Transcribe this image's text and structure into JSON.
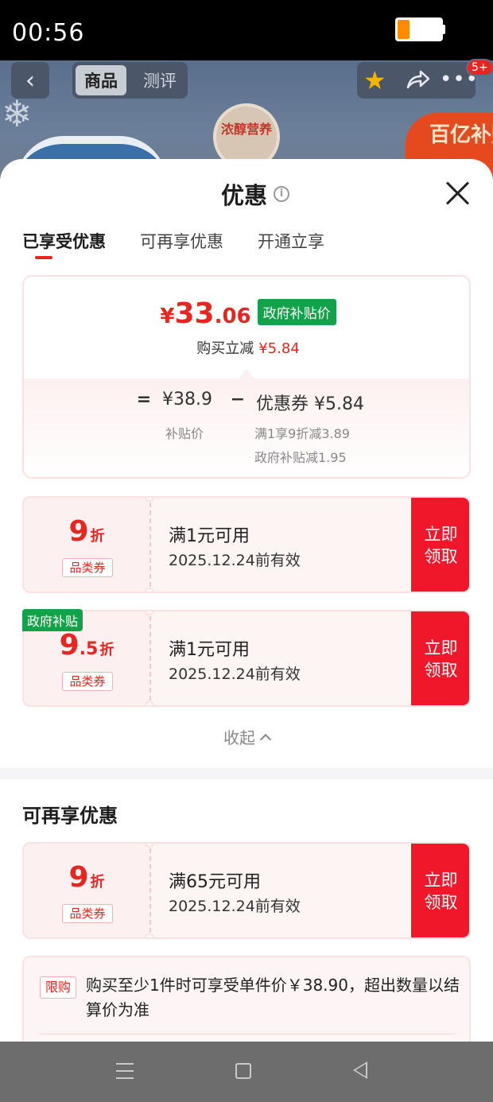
{
  "status_bar": {
    "time": "00:56"
  },
  "header": {
    "tabs": [
      "商品",
      "测评"
    ],
    "badge_text": "浓醇营养",
    "promo_badge": "百亿补贴",
    "notification_count": "5+"
  },
  "sheet": {
    "title": "优惠",
    "tabs": [
      "已享受优惠",
      "可再享优惠",
      "开通立享"
    ],
    "summary": {
      "price_yen": "¥",
      "price_int": "33",
      "price_dec": ".06",
      "price_tag": "政府补贴价",
      "reduce_label": "购买立减",
      "reduce_amount": "¥5.84",
      "eq": "=",
      "subsidy_price": "¥38.9",
      "minus": "−",
      "coupon_total": "优惠券 ¥5.84",
      "subsidy_price_label": "补贴价",
      "detail_1": "满1享9折减3.89",
      "detail_2": "政府补贴减1.95"
    },
    "coupons": [
      {
        "discount_int": "9",
        "discount_dec": "",
        "unit": "折",
        "category": "品类券",
        "condition": "满1元可用",
        "valid": "2025.12.24前有效",
        "action": "立即\n领取"
      },
      {
        "corner_tag": "政府补贴",
        "discount_int": "9",
        "discount_dec": ".5",
        "unit": "折",
        "category": "品类券",
        "condition": "满1元可用",
        "valid": "2025.12.24前有效",
        "action": "立即\n领取"
      }
    ],
    "collapse_label": "收起",
    "more_section_title": "可再享优惠",
    "more_coupons": [
      {
        "discount_int": "9",
        "discount_dec": "",
        "unit": "折",
        "category": "品类券",
        "condition": "满65元可用",
        "valid": "2025.12.24前有效",
        "action": "立即\n领取"
      }
    ],
    "limit": {
      "tag": "限购",
      "text": "购买至少1件时可享受单件价￥38.90，超出数量以结算价为准"
    }
  },
  "colors": {
    "accent": "#e8261f",
    "gov_green": "#12a24a",
    "claim_btn": "#f0172b"
  }
}
